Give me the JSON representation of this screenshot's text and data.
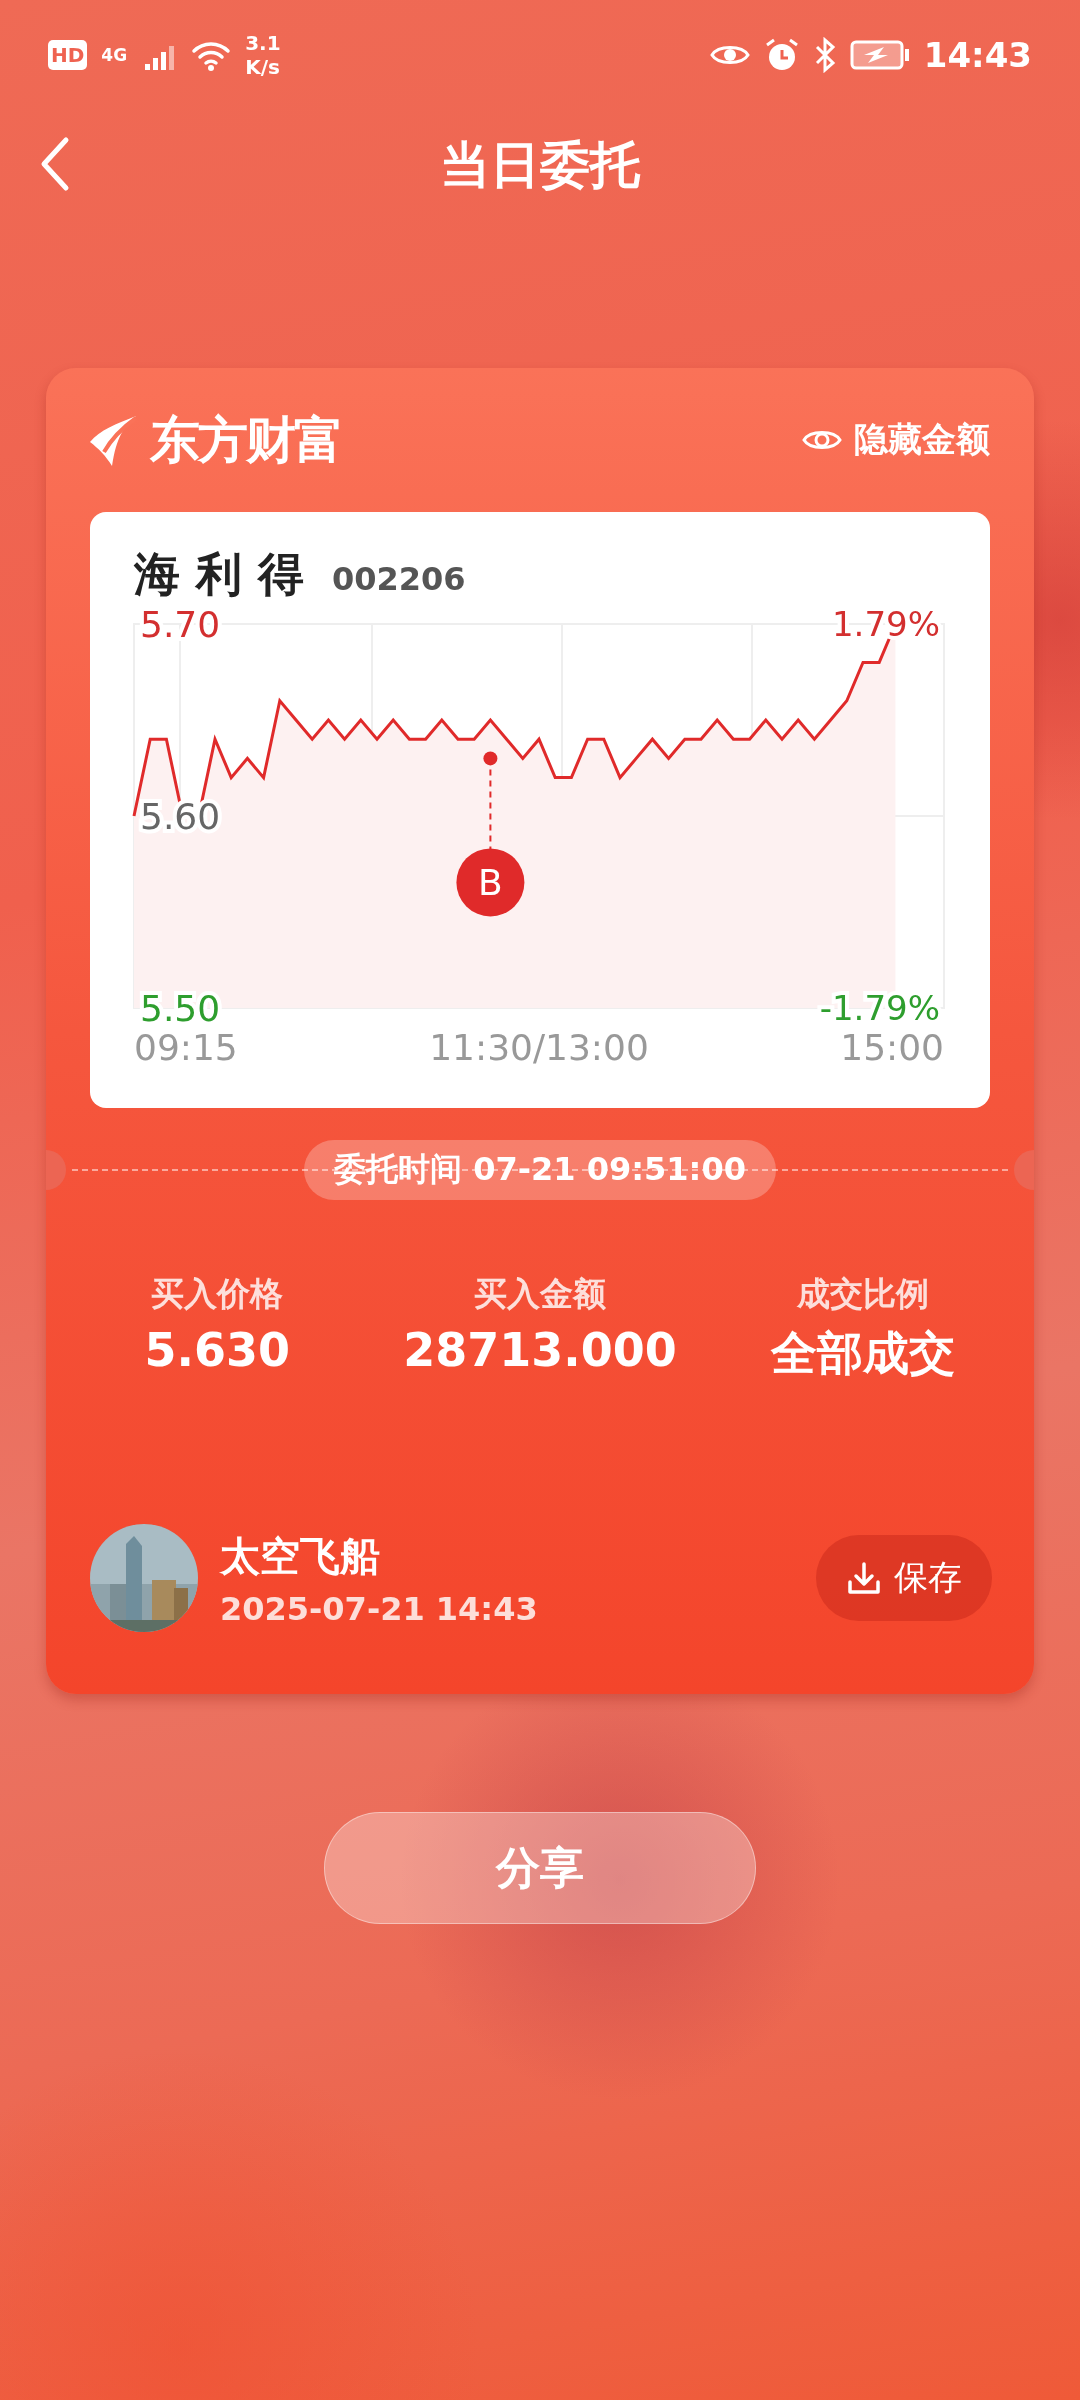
{
  "status_bar": {
    "hd": "HD",
    "network": "4G",
    "speed_value": "3.1",
    "speed_unit": "K/s",
    "time": "14:43"
  },
  "header": {
    "title": "当日委托"
  },
  "card": {
    "brand": "东方财富",
    "hide_amount": "隐藏金额",
    "stock": {
      "name": "海 利 得",
      "code": "002206",
      "change_high": "1.79%",
      "change_low": "-1.79%",
      "time_labels": [
        "09:15",
        "11:30/13:00",
        "15:00"
      ],
      "chart_data": {
        "type": "line",
        "ylim": [
          5.5,
          5.7
        ],
        "grid": true,
        "yticks": [
          {
            "value": 5.7,
            "label": "5.70"
          },
          {
            "value": 5.6,
            "label": "5.60"
          },
          {
            "value": 5.5,
            "label": "5.50"
          }
        ],
        "series": [
          {
            "color": "#e02a2a",
            "values": [
              5.6,
              5.64,
              5.64,
              5.6,
              5.6,
              5.64,
              5.62,
              5.63,
              5.62,
              5.66,
              5.65,
              5.64,
              5.65,
              5.64,
              5.65,
              5.64,
              5.65,
              5.64,
              5.64,
              5.65,
              5.64,
              5.64,
              5.65,
              5.64,
              5.63,
              5.64,
              5.62,
              5.62,
              5.64,
              5.64,
              5.62,
              5.63,
              5.64,
              5.63,
              5.64,
              5.64,
              5.65,
              5.64,
              5.64,
              5.65,
              5.64,
              5.65,
              5.64,
              5.65,
              5.66,
              5.68,
              5.68,
              5.7
            ]
          }
        ],
        "annotations": [
          {
            "y": 5.63,
            "text": "B"
          }
        ]
      }
    },
    "order_time": "委托时间 07-21 09:51:00",
    "stats": [
      {
        "label": "买入价格",
        "value": "5.630"
      },
      {
        "label": "买入金额",
        "value": "28713.000"
      },
      {
        "label": "成交比例",
        "value": "全部成交"
      }
    ],
    "user": {
      "name": "太空飞船",
      "time": "2025-07-21 14:43"
    },
    "save": "保存"
  },
  "share": "分享"
}
